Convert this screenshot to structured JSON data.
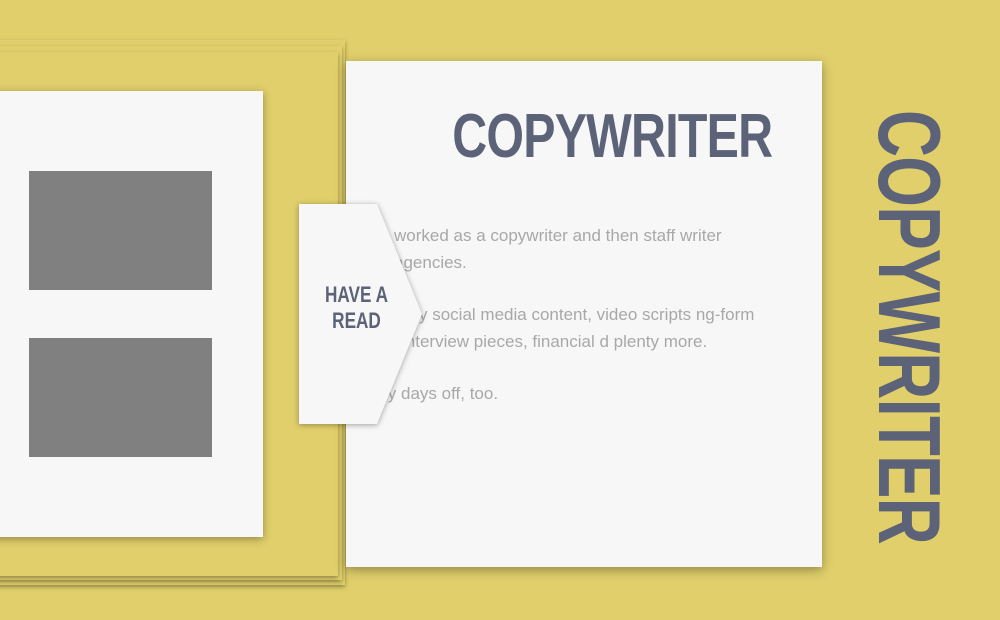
{
  "page": {
    "background": "#e0cf6a",
    "accent": "#5c6278"
  },
  "main_card": {
    "title": "COPYWRITER",
    "paragraphs": [
      "worked as a copywriter and then staff writer agencies.",
      "aily social media content, video scripts ng-form interview pieces, financial d plenty more.",
      "on my days off, too."
    ]
  },
  "read_button": {
    "line1": "HAVE A",
    "line2": "READ",
    "icon": "chevron-tab-icon"
  },
  "side_card": {
    "thumbnails": [
      "thumbnail",
      "thumbnail"
    ]
  },
  "vertical_title": "COPYWRITER"
}
